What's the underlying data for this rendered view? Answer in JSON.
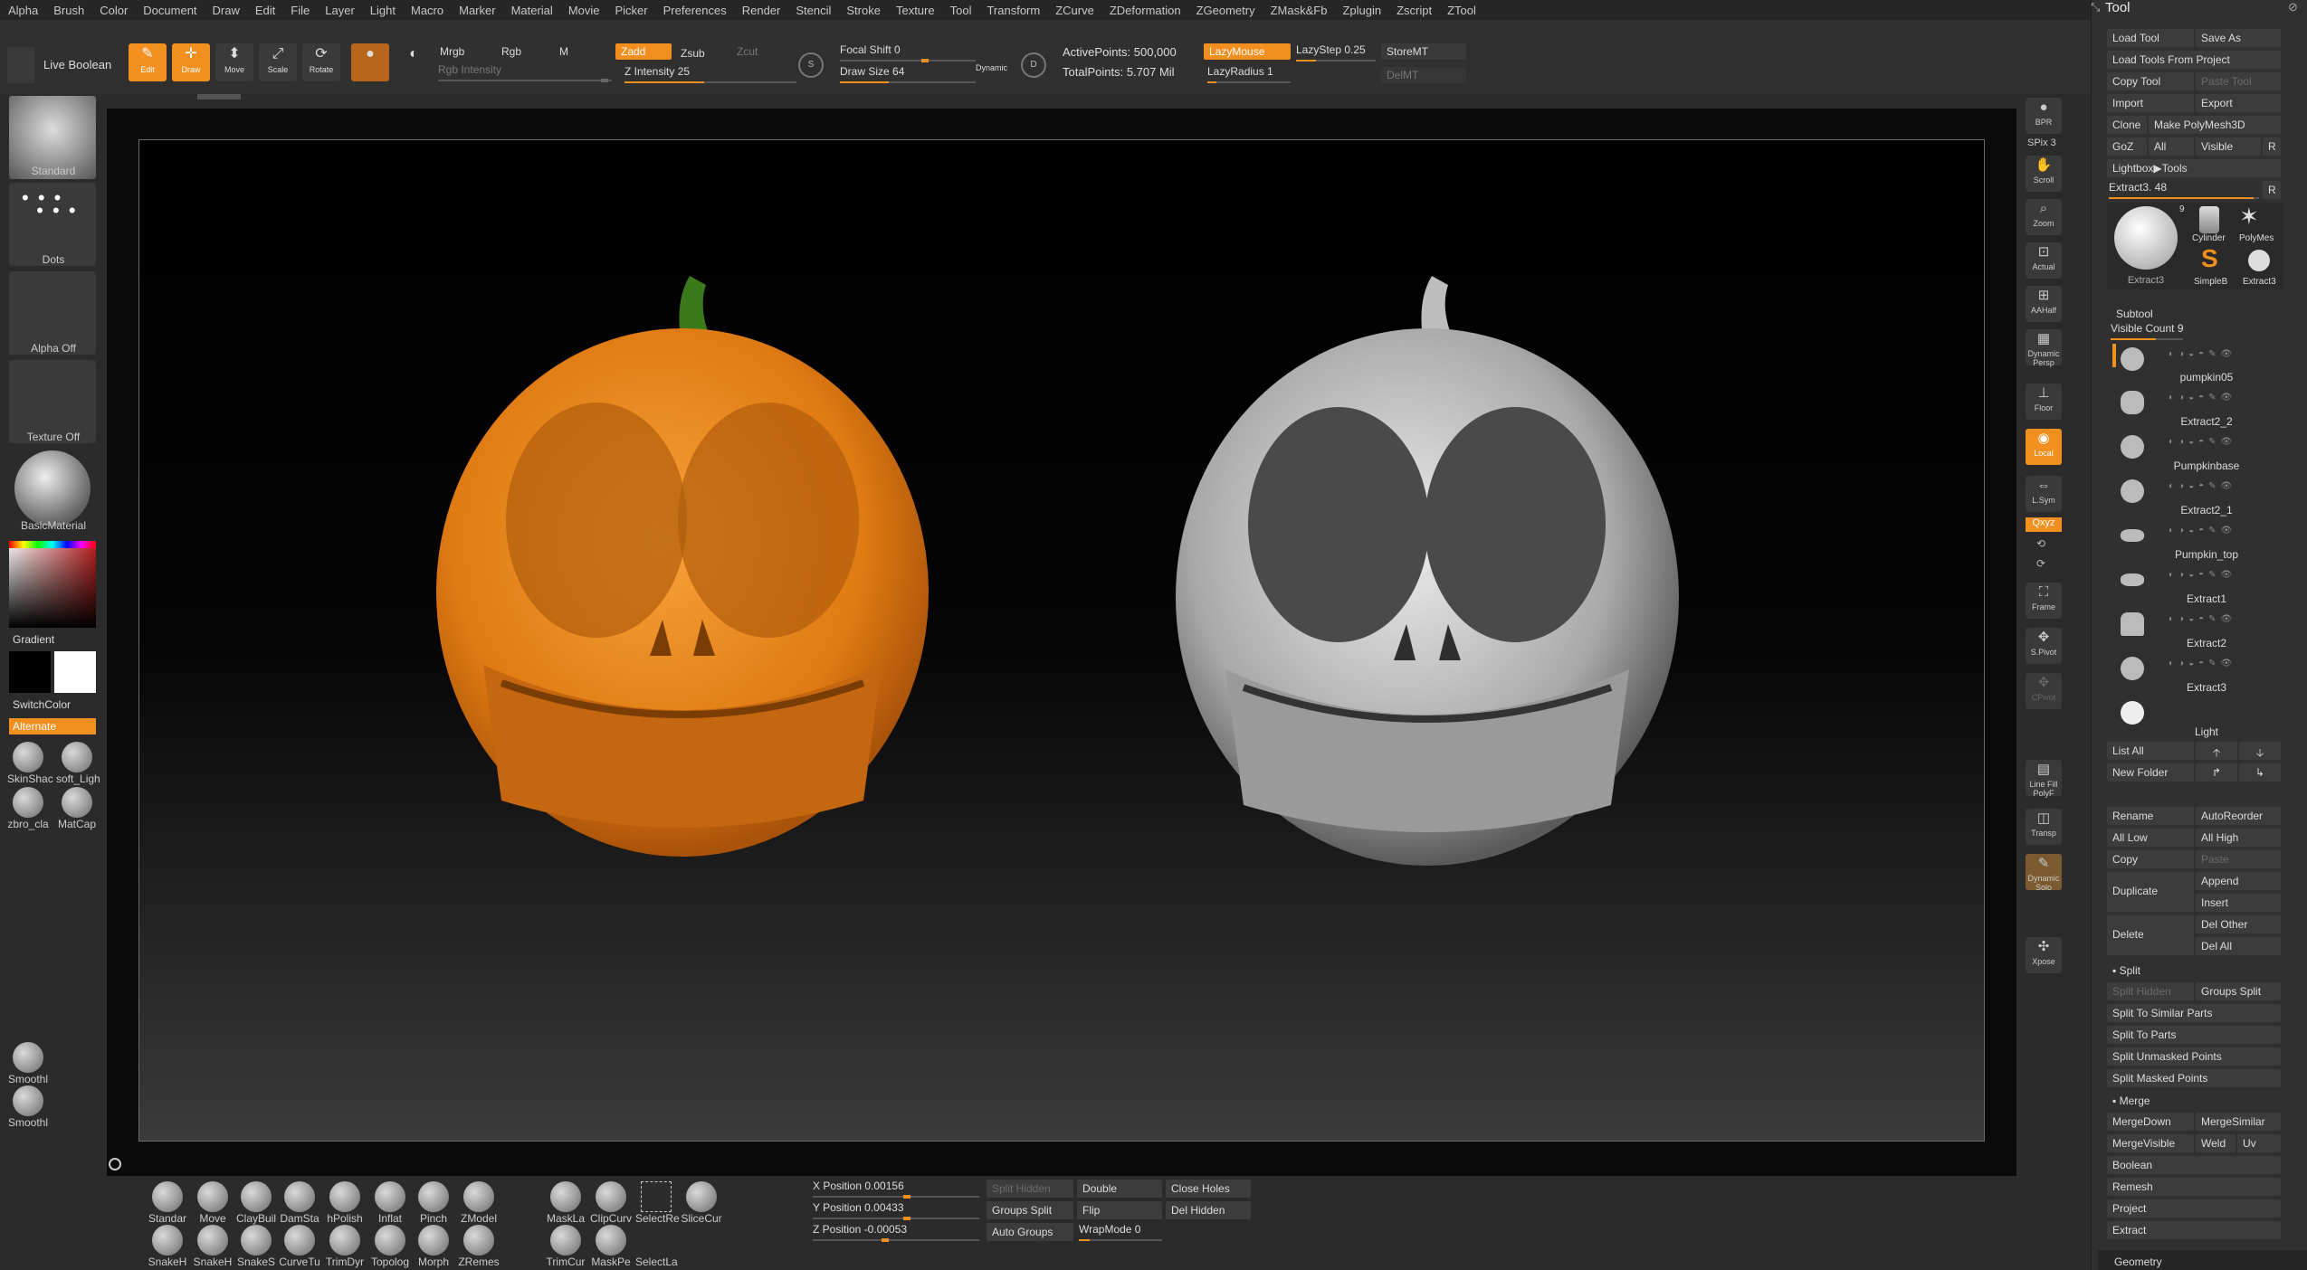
{
  "menu": [
    "Alpha",
    "Brush",
    "Color",
    "Document",
    "Draw",
    "Edit",
    "File",
    "Layer",
    "Light",
    "Macro",
    "Marker",
    "Material",
    "Movie",
    "Picker",
    "Preferences",
    "Render",
    "Stencil",
    "Stroke",
    "Texture",
    "Tool",
    "Transform",
    "ZCurve",
    "ZDeformation",
    "ZGeometry",
    "ZMask&Fb",
    "Zplugin",
    "Zscript",
    "ZTool"
  ],
  "toolbar": {
    "live_boolean": "Live Boolean",
    "edit": "Edit",
    "draw": "Draw",
    "move": "Move",
    "scale": "Scale",
    "rotate": "Rotate",
    "mrgb": "Mrgb",
    "rgb": "Rgb",
    "m": "M",
    "rgb_intensity": "Rgb Intensity",
    "zadd": "Zadd",
    "zsub": "Zsub",
    "zcut": "Zcut",
    "z_intensity": "Z Intensity 25",
    "focal_shift": "Focal Shift 0",
    "draw_size": "Draw Size 64",
    "dynamic": "Dynamic",
    "active_points": "ActivePoints: 500,000",
    "total_points": "TotalPoints: 5.707 Mil",
    "lazymouse": "LazyMouse",
    "lazystep": "LazyStep 0.25",
    "lazyradius": "LazyRadius 1",
    "storemt": "StoreMT",
    "delmt": "DelMT"
  },
  "left": {
    "brush": "Standard",
    "stroke": "Dots",
    "alpha": "Alpha Off",
    "texture": "Texture Off",
    "material": "BasicMaterial",
    "gradient": "Gradient",
    "switchcolor": "SwitchColor",
    "alternate": "Alternate",
    "mats": [
      "SkinShac",
      "soft_Ligh",
      "zbro_cla",
      "MatCap"
    ],
    "smooth": [
      "Smoothl",
      "Smoothl"
    ]
  },
  "right_shelf": [
    "BPR",
    "SPix 3",
    "Scroll",
    "Zoom",
    "Actual",
    "AAHalf",
    "Dynamic Persp",
    "Floor",
    "Local",
    "L.Sym",
    "Qxyz",
    "Frame",
    "S.Pivot",
    "CPivot",
    "Line Fill PolyF",
    "Transp",
    "Dynamic Solo",
    "Xpose"
  ],
  "tool": {
    "title": "Tool",
    "load_tool": "Load Tool",
    "save_as": "Save As",
    "load_from_project": "Load Tools From Project",
    "copy_tool": "Copy Tool",
    "paste_tool": "Paste Tool",
    "import": "Import",
    "export": "Export",
    "clone": "Clone",
    "make_polymesh": "Make PolyMesh3D",
    "goz": "GoZ",
    "all": "All",
    "visible": "Visible",
    "r": "R",
    "lightbox": "Lightbox▶Tools",
    "extract_slider": "Extract3. 48",
    "thumb_main": "Extract3",
    "thumb_count": "9",
    "thumb_cyl": "Cylinder",
    "thumb_poly": "PolyMes",
    "thumb_simple": "SimpleB",
    "thumb_ex": "Extract3",
    "subtool": "Subtool",
    "visible_count": "Visible Count 9",
    "subtools": [
      "pumpkin05",
      "Extract2_2",
      "Pumpkinbase",
      "Extract2_1",
      "Pumpkin_top",
      "Extract1",
      "Extract2",
      "Extract3",
      "Light"
    ],
    "list_all": "List All",
    "new_folder": "New Folder",
    "rename": "Rename",
    "autoreorder": "AutoReorder",
    "all_low": "All Low",
    "all_high": "All High",
    "copy": "Copy",
    "paste": "Paste",
    "duplicate": "Duplicate",
    "append": "Append",
    "insert": "Insert",
    "delete": "Delete",
    "del_other": "Del Other",
    "del_all": "Del All",
    "split": "Split",
    "split_hidden": "Split Hidden",
    "groups_split": "Groups Split",
    "split_similar": "Split To Similar Parts",
    "split_parts": "Split To Parts",
    "split_unmasked": "Split Unmasked Points",
    "split_masked": "Split Masked Points",
    "merge": "Merge",
    "mergedown": "MergeDown",
    "mergesimilar": "MergeSimilar",
    "mergevisible": "MergeVisible",
    "weld": "Weld",
    "uv": "Uv",
    "boolean": "Boolean",
    "remesh": "Remesh",
    "project": "Project",
    "extract": "Extract",
    "geometry": "Geometry"
  },
  "bottom": {
    "brushes_row1": [
      "Standar",
      "Move",
      "ClayBuil",
      "DamSta",
      "hPolish",
      "Inflat",
      "Pinch",
      "ZModel"
    ],
    "brushes_row2": [
      "SnakeH",
      "SnakeH",
      "SnakeS",
      "CurveTu",
      "TrimDyr",
      "Topolog",
      "Morph",
      "ZRemes"
    ],
    "mask_row1": [
      "MaskLa",
      "ClipCurv",
      "SelectRe",
      "SliceCur"
    ],
    "mask_row2": [
      "TrimCur",
      "MaskPe",
      "SelectLa"
    ],
    "xpos": "X Position 0.00156",
    "ypos": "Y Position 0.00433",
    "zpos": "Z Position -0.00053",
    "split_hidden": "Split Hidden",
    "groups_split": "Groups Split",
    "auto_groups": "Auto Groups",
    "double": "Double",
    "flip": "Flip",
    "wrapmode": "WrapMode 0",
    "close_holes": "Close Holes",
    "del_hidden": "Del Hidden"
  },
  "colors": {
    "accent": "#f28f1e",
    "panel": "#303030",
    "canvas": "#0a0a0a"
  }
}
